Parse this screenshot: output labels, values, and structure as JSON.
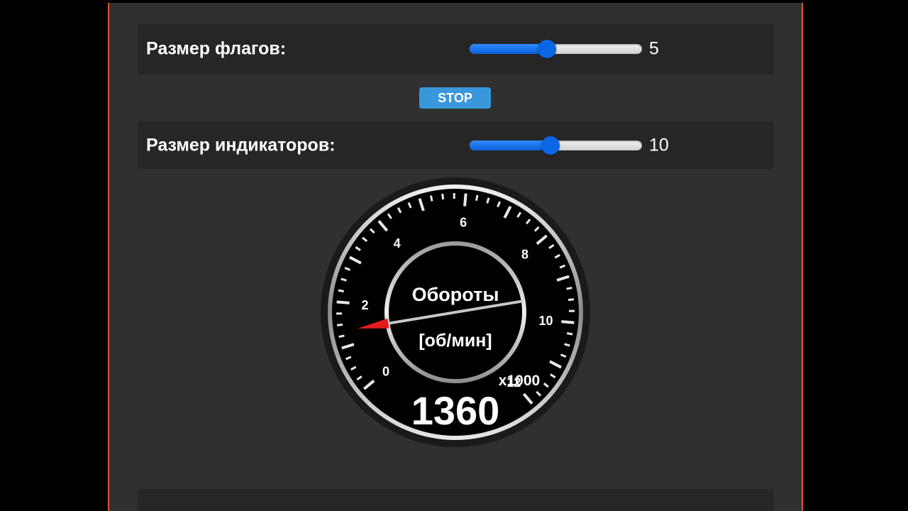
{
  "settings": {
    "flags_size": {
      "label": "Размер флагов:",
      "value": "5",
      "fraction": 0.45
    },
    "indicators_size": {
      "label": "Размер индикаторов:",
      "value": "10",
      "fraction": 0.47
    }
  },
  "stop_button": {
    "label": "STOP"
  },
  "gauge": {
    "title": "Обороты",
    "unit": "[об/мин]",
    "multiplier": "x1000",
    "reading": "1360",
    "value_thousands": 1.36,
    "min": 0,
    "max": 12,
    "tick_labels": [
      "0",
      "2",
      "4",
      "6",
      "8",
      "10",
      "12"
    ],
    "colors": {
      "needle": "#e31b1b",
      "bezel": "#c8c8c8",
      "face": "#000000"
    }
  }
}
